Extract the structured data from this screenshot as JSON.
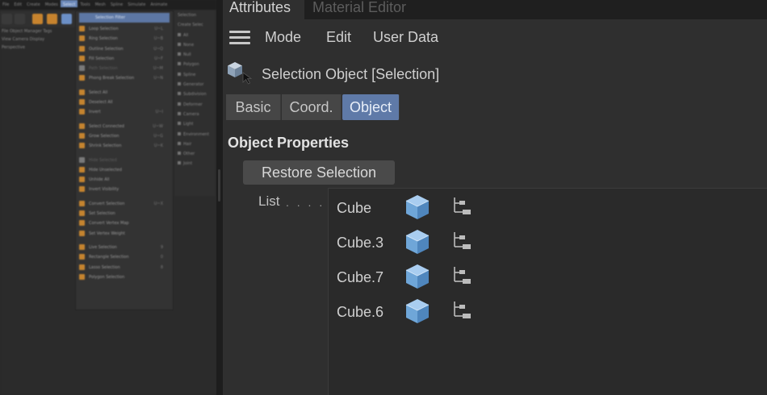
{
  "attributes_panel": {
    "tabs": [
      {
        "label": "Attributes",
        "active": true
      },
      {
        "label": "Material Editor",
        "active": false
      }
    ],
    "menu": {
      "mode_label": "Mode",
      "edit_label": "Edit",
      "userdata_label": "User Data"
    },
    "object_title": "Selection Object [Selection]",
    "object_icon": "cube-icon",
    "subtabs": [
      {
        "label": "Basic",
        "active": false
      },
      {
        "label": "Coord.",
        "active": false
      },
      {
        "label": "Object",
        "active": true
      }
    ],
    "section_header": "Object Properties",
    "restore_button": "Restore Selection",
    "list_label": "List",
    "list_dots": ". . . .",
    "list_items": [
      {
        "name": "Cube",
        "icon": "cube-icon",
        "action_icon": "hierarchy-icon"
      },
      {
        "name": "Cube.3",
        "icon": "cube-icon",
        "action_icon": "hierarchy-icon"
      },
      {
        "name": "Cube.7",
        "icon": "cube-icon",
        "action_icon": "hierarchy-icon"
      },
      {
        "name": "Cube.6",
        "icon": "cube-icon",
        "action_icon": "hierarchy-icon"
      }
    ]
  },
  "colors": {
    "accent": "#5f7aa8",
    "panel_bg": "#2f2f2f",
    "cube_blue": "#6fa6d8"
  }
}
